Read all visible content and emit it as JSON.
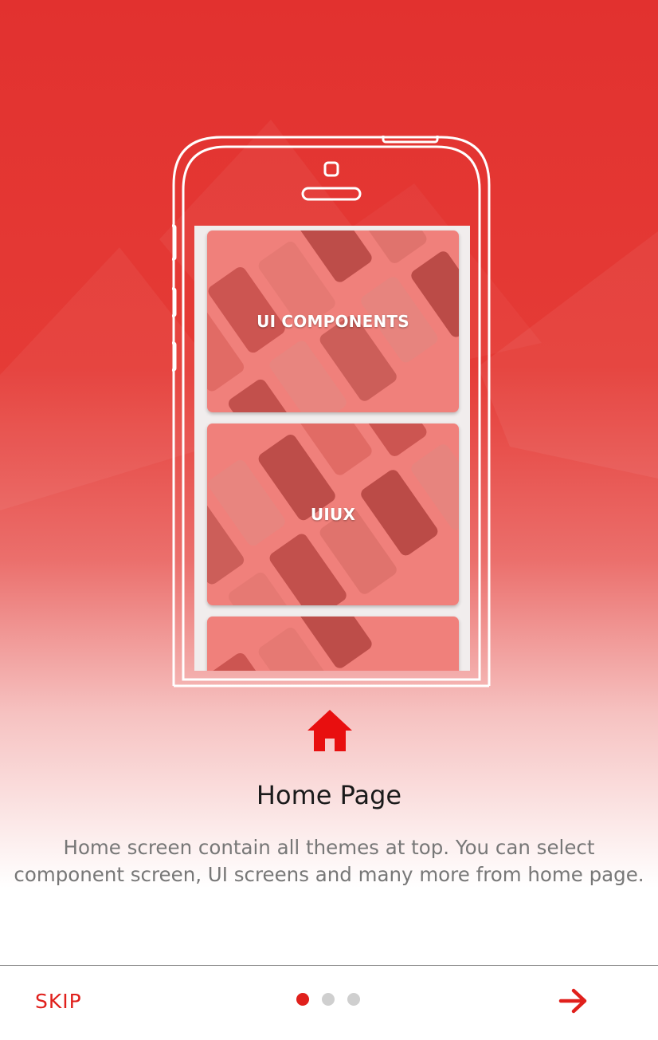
{
  "slide": {
    "title": "Home Page",
    "description": "Home screen contain all themes at top. You can select component screen, UI screens and many more from home page.",
    "icon": "home-icon"
  },
  "phone_screen": {
    "cards": [
      {
        "label": "UI COMPONENTS"
      },
      {
        "label": "UIUX"
      },
      {
        "label": ""
      }
    ]
  },
  "footer": {
    "skip_label": "SKIP",
    "next_icon": "arrow-right-icon",
    "pager": {
      "total": 3,
      "active": 1
    }
  },
  "colors": {
    "accent": "#e0201c",
    "background_top": "#e2312f",
    "dot_inactive": "#cfcfcf",
    "text_secondary": "#777777"
  }
}
